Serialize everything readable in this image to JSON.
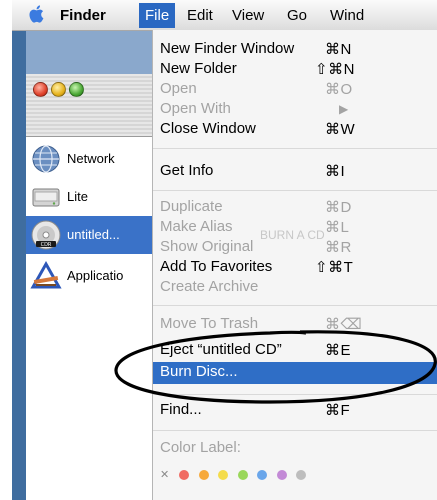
{
  "menubar": {
    "app_name": "Finder",
    "items": [
      "File",
      "Edit",
      "View",
      "Go",
      "Wind"
    ]
  },
  "sidebar": {
    "items": [
      {
        "label": "Network",
        "icon": "network-globe-icon"
      },
      {
        "label": "Lite",
        "icon": "hard-drive-icon"
      },
      {
        "label": "untitled...",
        "icon": "cdr-disc-icon",
        "selected": true
      },
      {
        "label": "Applicatio",
        "icon": "applications-icon"
      }
    ]
  },
  "file_menu": {
    "items": [
      {
        "label": "New Finder Window",
        "shortcut": "⌘N",
        "enabled": true
      },
      {
        "label": "New Folder",
        "shortcut": "⇧⌘N",
        "enabled": true
      },
      {
        "label": "Open",
        "shortcut": "⌘O",
        "enabled": false
      },
      {
        "label": "Open With",
        "shortcut": "▶",
        "enabled": false
      },
      {
        "label": "Close Window",
        "shortcut": "⌘W",
        "enabled": true
      },
      {
        "label": "Get Info",
        "shortcut": "⌘I",
        "enabled": true
      },
      {
        "label": "Duplicate",
        "shortcut": "⌘D",
        "enabled": false
      },
      {
        "label": "Make Alias",
        "shortcut": "⌘L",
        "enabled": false
      },
      {
        "label": "Show Original",
        "shortcut": "⌘R",
        "enabled": false
      },
      {
        "label": "Add To Favorites",
        "shortcut": "⇧⌘T",
        "enabled": true
      },
      {
        "label": "Create Archive",
        "shortcut": "",
        "enabled": false
      },
      {
        "label": "Move To Trash",
        "shortcut": "⌘⌫",
        "enabled": false
      },
      {
        "label": "Eject “untitled CD”",
        "shortcut": "⌘E",
        "enabled": true
      },
      {
        "label": "Burn Disc...",
        "shortcut": "",
        "enabled": true,
        "highlighted": true
      },
      {
        "label": "Find...",
        "shortcut": "⌘F",
        "enabled": true
      },
      {
        "label": "Color Label:",
        "shortcut": "",
        "enabled": false
      }
    ],
    "color_labels": [
      "#f06b63",
      "#f7a93b",
      "#f4dc4a",
      "#9ad75a",
      "#6aa6ea",
      "#c38ad6",
      "#bdbdbd"
    ],
    "annotation_color": "#000000"
  },
  "background_hint": "BURN A CD"
}
